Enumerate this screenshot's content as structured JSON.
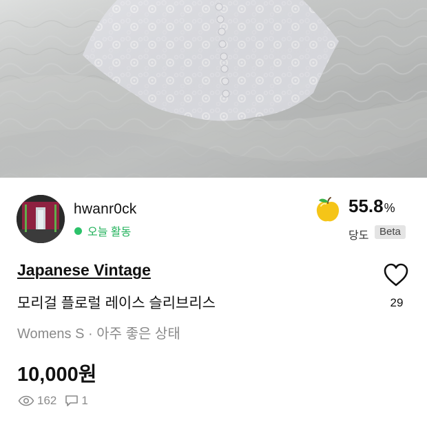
{
  "seller": {
    "username": "hwanr0ck",
    "activity": "오늘 활동"
  },
  "manner": {
    "score": "55.8",
    "unit": "%",
    "label": "당도",
    "badge": "Beta",
    "level": 0.558
  },
  "listing": {
    "shop_name": "Japanese Vintage",
    "title": "모리걸 플로럴 레이스 슬리브리스",
    "meta": "Womens S · 아주 좋은 상태",
    "price": "10,000원",
    "likes": "29",
    "views": "162",
    "chats": "1"
  },
  "icons": {
    "fruit": "yellow-fruit-icon",
    "heart": "heart-outline-icon",
    "eye": "eye-icon",
    "chat": "chat-bubble-icon"
  },
  "colors": {
    "activity_green": "#20b15a",
    "fruit_yellow": "#f5c518",
    "muted_text": "#8a8a8a"
  }
}
